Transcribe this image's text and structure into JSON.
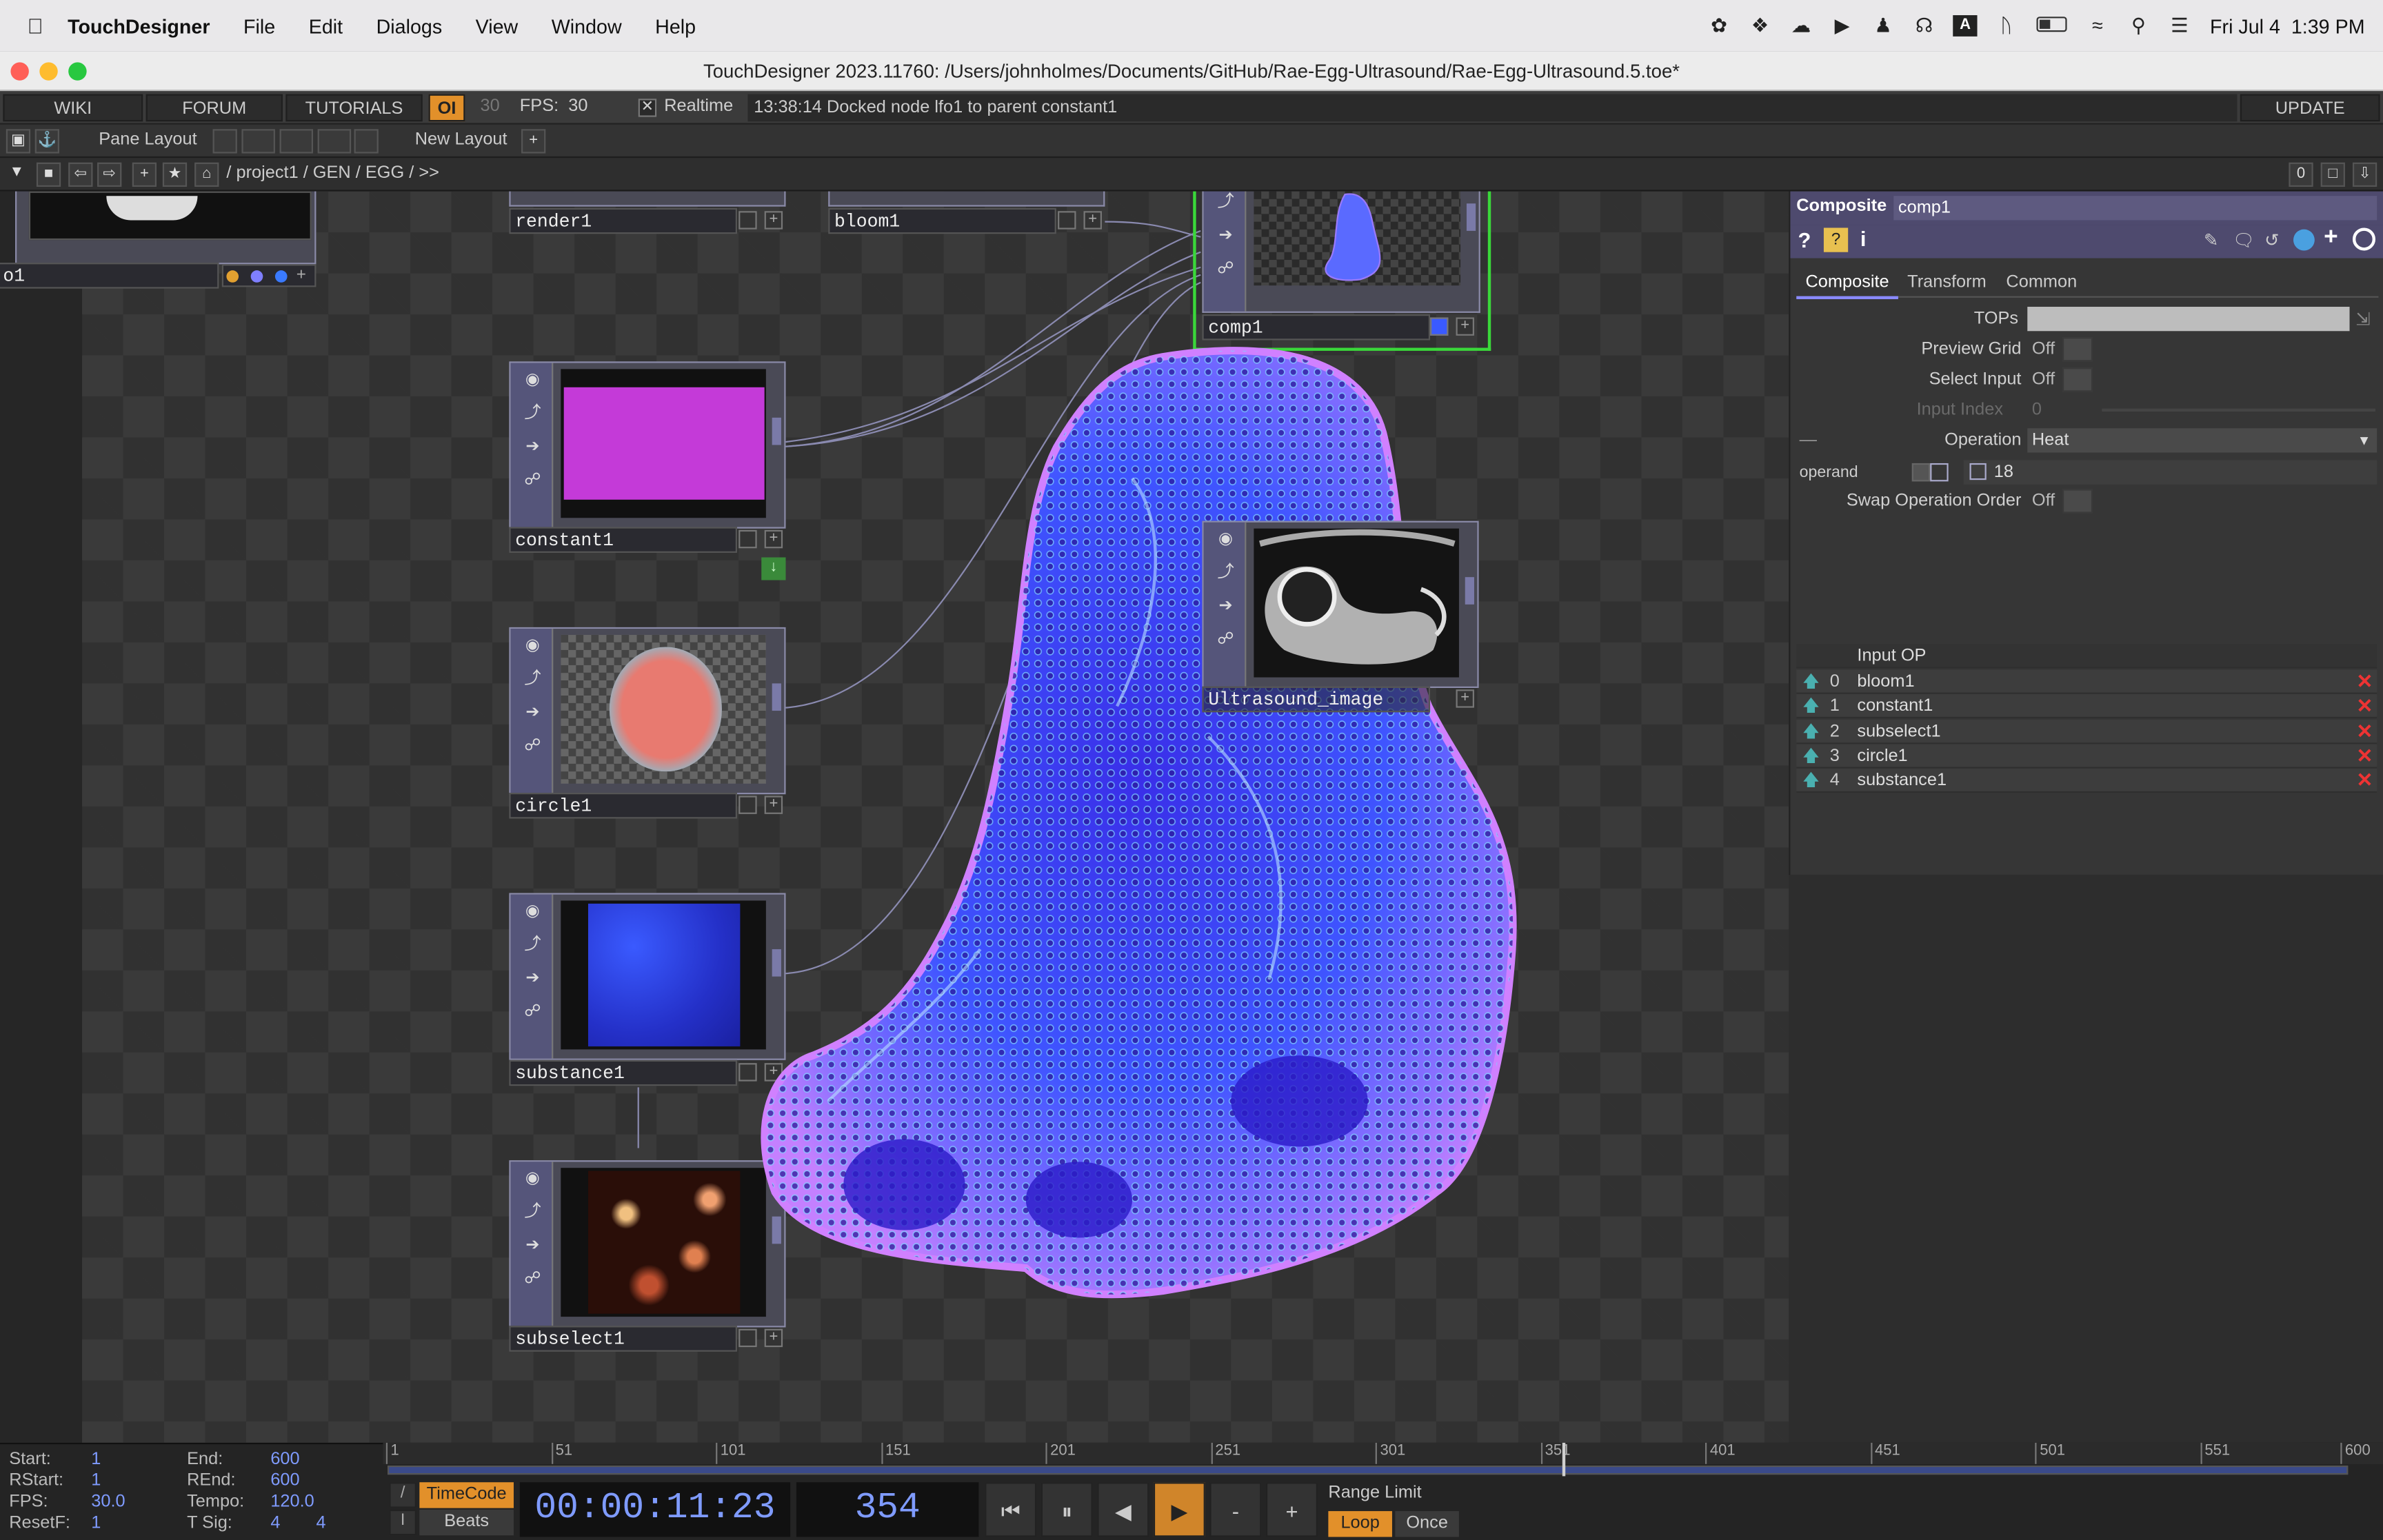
{
  "menubar": {
    "app": "TouchDesigner",
    "items": [
      "File",
      "Edit",
      "Dialogs",
      "View",
      "Window",
      "Help"
    ],
    "clock": "Fri Jul 4  1:39 PM"
  },
  "window": {
    "title": "TouchDesigner 2023.11760: /Users/johnholmes/Documents/GitHub/Rae-Egg-Ultrasound/Rae-Egg-Ultrasound.5.toe*"
  },
  "toolbar": {
    "wiki": "WIKI",
    "forum": "FORUM",
    "tutorials": "TUTORIALS",
    "oi": "OI",
    "fps_cap": "30",
    "fps": "FPS:  30",
    "realtime_check": "✕",
    "realtime": "Realtime",
    "status": "13:38:14 Docked node lfo1 to parent constant1",
    "update": "UPDATE"
  },
  "panebar": {
    "pane_layout": "Pane Layout",
    "new_layout": "New Layout"
  },
  "pathbar": {
    "path": "/ project1 / GEN / EGG / >>",
    "right_num": "0"
  },
  "nodes": {
    "render1": "render1",
    "bloom1": "bloom1",
    "comp1": "comp1",
    "constant1": "constant1",
    "circle1": "circle1",
    "substance1": "substance1",
    "subselect1": "subselect1",
    "ultrasound": "Ultrasound_image",
    "partial_left": "o1"
  },
  "params": {
    "op_type": "Composite",
    "op_name": "comp1",
    "tabs": [
      "Composite",
      "Transform",
      "Common"
    ],
    "tops_label": "TOPs",
    "preview_grid_label": "Preview Grid",
    "preview_grid": "Off",
    "select_input_label": "Select Input",
    "select_input": "Off",
    "input_index_label": "Input Index",
    "input_index": "0",
    "operation_label": "Operation",
    "operation": "Heat",
    "operand_label": "operand",
    "operand_value": "18",
    "swap_label": "Swap Operation Order",
    "swap": "Off",
    "input_table_header": "Input OP",
    "inputs": [
      {
        "idx": "0",
        "name": "bloom1"
      },
      {
        "idx": "1",
        "name": "constant1"
      },
      {
        "idx": "2",
        "name": "subselect1"
      },
      {
        "idx": "3",
        "name": "circle1"
      },
      {
        "idx": "4",
        "name": "substance1"
      }
    ]
  },
  "timeline": {
    "start_label": "Start:",
    "start": "1",
    "rstart_label": "RStart:",
    "rstart": "1",
    "fps_label": "FPS:",
    "fps": "30.0",
    "resetf_label": "ResetF:",
    "resetf": "1",
    "end_label": "End:",
    "end": "600",
    "rend_label": "REnd:",
    "rend": "600",
    "tempo_label": "Tempo:",
    "tempo": "120.0",
    "tsig_label": "T Sig:",
    "tsig_a": "4",
    "tsig_b": "4",
    "ticks": [
      "1",
      "51",
      "101",
      "151",
      "201",
      "251",
      "301",
      "351",
      "401",
      "451",
      "501",
      "551",
      "600"
    ],
    "timecode_label": "TimeCode",
    "beats_label": "Beats",
    "timecode": "00:00:11:23",
    "frame": "354",
    "range_limit": "Range Limit",
    "loop": "Loop",
    "once": "Once",
    "slash": "/",
    "bar": "I",
    "minus": "-",
    "plus": "+"
  },
  "colors": {
    "accent": "#f0a030",
    "selected": "#44dd44",
    "panel": "#363636"
  }
}
